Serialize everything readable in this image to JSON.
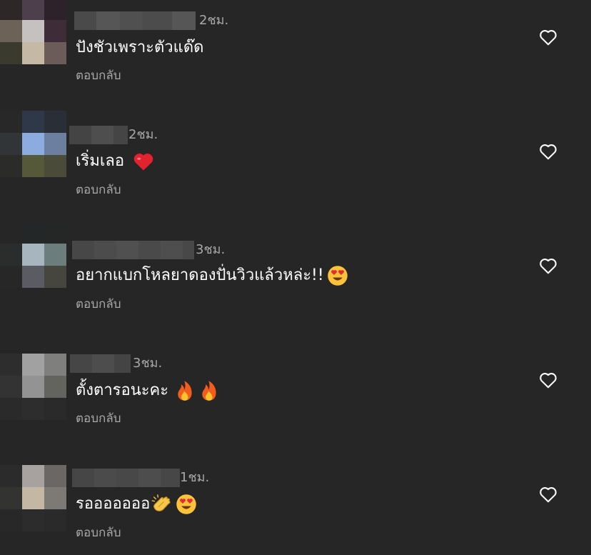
{
  "colors": {
    "background": "#262626",
    "text": "#ffffff",
    "muted": "#a8a8a8"
  },
  "comments": [
    {
      "time": "2ชม.",
      "text": "ปังชัวเพราะตัวแด๊ด",
      "emojis": [],
      "reply": "ตอบกลับ"
    },
    {
      "time": "2ชม.",
      "text": "เริ่มเลอ",
      "emojis": [
        "red-heart"
      ],
      "reply": "ตอบกลับ"
    },
    {
      "time": "3ชม.",
      "text": "อยากแบกโหลยาดองปั่นวิวแล้วหล่ะ!!",
      "emojis": [
        "heart-eyes"
      ],
      "reply": "ตอบกลับ"
    },
    {
      "time": "3ชม.",
      "text": "ตั้งตารอนะคะ",
      "emojis": [
        "fire",
        "fire"
      ],
      "reply": "ตอบกลับ"
    },
    {
      "time": "1ชม.",
      "text": "รอออออออ",
      "emojis": [
        "clapping-hands",
        "heart-eyes"
      ],
      "reply": "ตอบกลับ"
    }
  ],
  "icons": {
    "like": "heart-outline-icon"
  }
}
